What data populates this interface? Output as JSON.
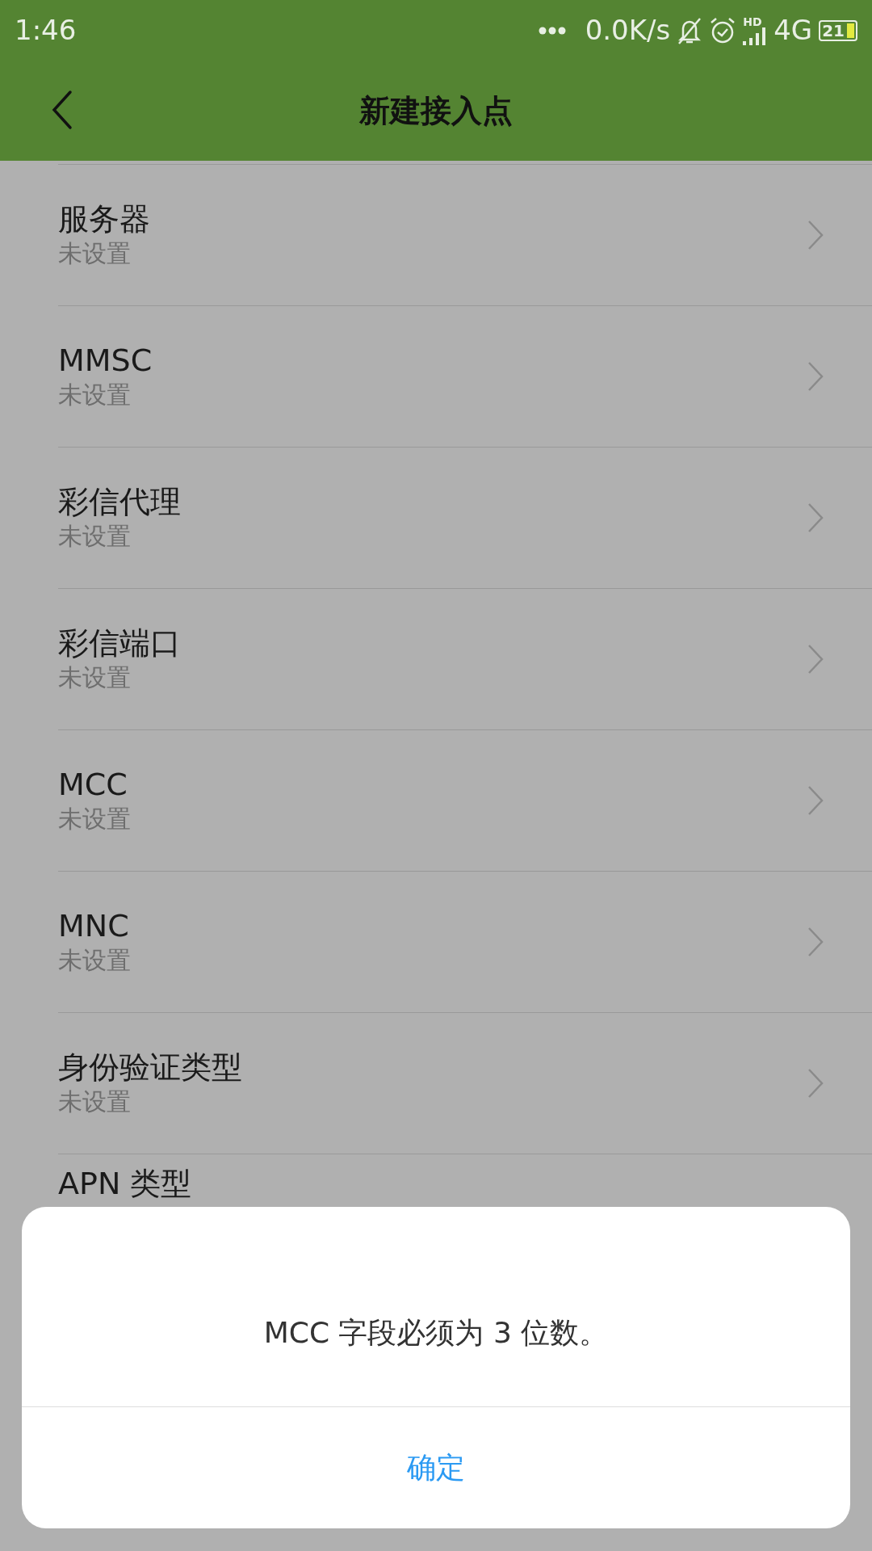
{
  "status_bar": {
    "time": "1:46",
    "net_speed": "0.0K/s",
    "hd": "HD",
    "network": "4G",
    "battery": "21"
  },
  "app_bar": {
    "title": "新建接入点"
  },
  "settings": [
    {
      "title": "服务器",
      "value": "未设置"
    },
    {
      "title": "MMSC",
      "value": "未设置"
    },
    {
      "title": "彩信代理",
      "value": "未设置"
    },
    {
      "title": "彩信端口",
      "value": "未设置"
    },
    {
      "title": "MCC",
      "value": "未设置"
    },
    {
      "title": "MNC",
      "value": "未设置"
    },
    {
      "title": "身份验证类型",
      "value": "未设置"
    },
    {
      "title": "APN 类型"
    }
  ],
  "dialog": {
    "message": "MCC 字段必须为 3 位数。",
    "buttons": [
      "确定"
    ]
  }
}
